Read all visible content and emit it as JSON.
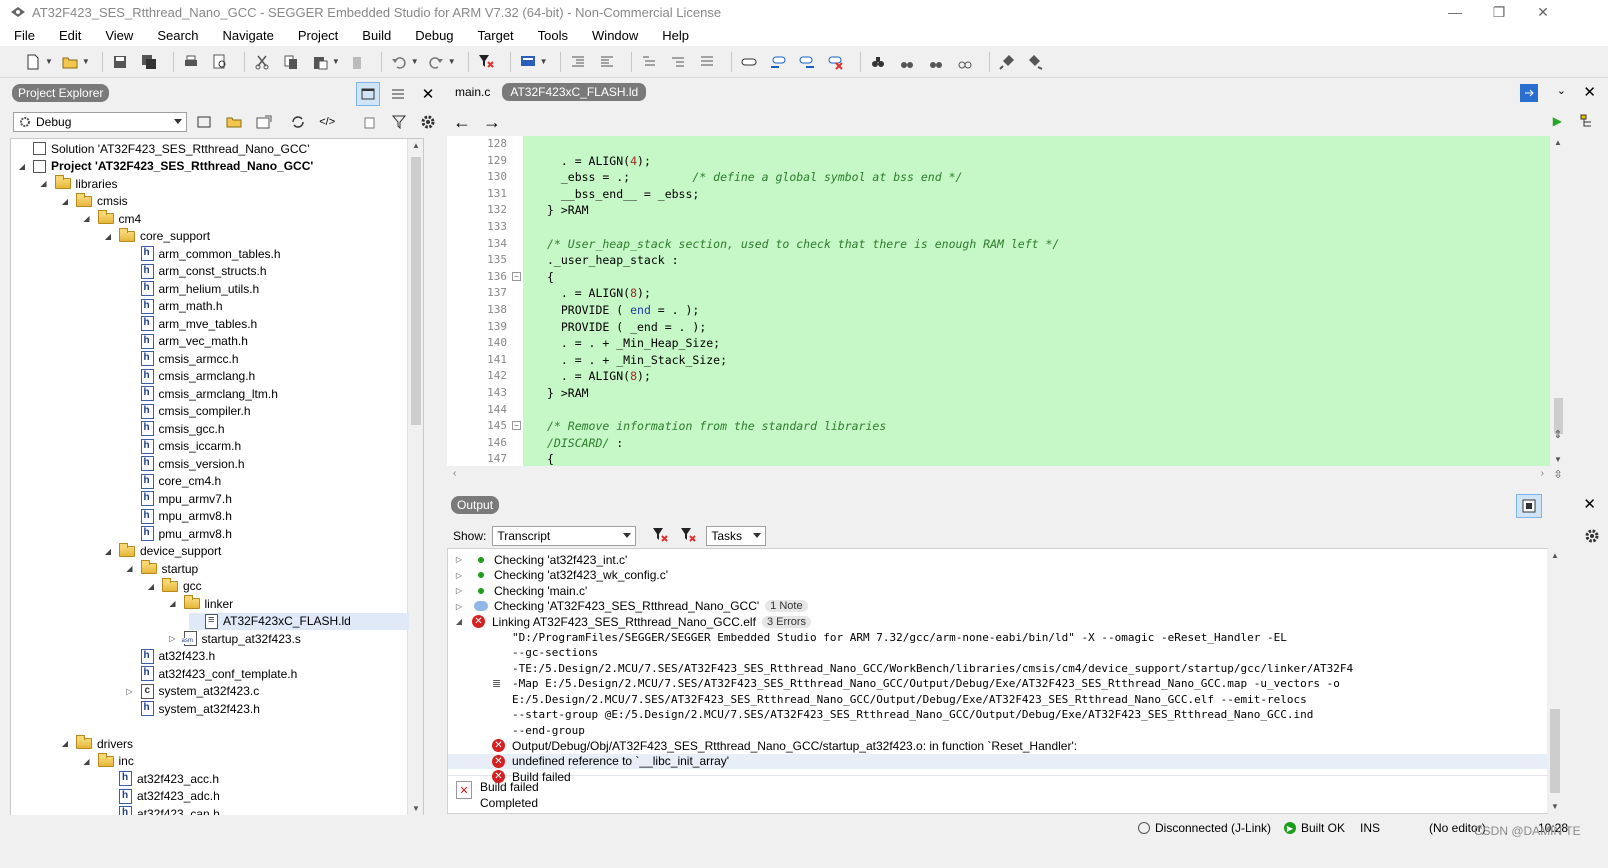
{
  "window": {
    "title": "AT32F423_SES_Rtthread_Nano_GCC - SEGGER Embedded Studio for ARM V7.32 (64-bit) - Non-Commercial License"
  },
  "menu": [
    "File",
    "Edit",
    "View",
    "Search",
    "Navigate",
    "Project",
    "Build",
    "Debug",
    "Target",
    "Tools",
    "Window",
    "Help"
  ],
  "project_explorer": {
    "header": "Project Explorer",
    "config": "Debug",
    "tree": [
      {
        "label": "Solution 'AT32F423_SES_Rtthread_Nano_GCC'",
        "depth": 0,
        "icon": "sol",
        "exp": ""
      },
      {
        "label": "Project 'AT32F423_SES_Rtthread_Nano_GCC'",
        "depth": 0,
        "icon": "proj",
        "exp": "◢",
        "bold": true
      },
      {
        "label": "libraries",
        "depth": 1,
        "icon": "folder",
        "exp": "◢"
      },
      {
        "label": "cmsis",
        "depth": 2,
        "icon": "folder",
        "exp": "◢"
      },
      {
        "label": "cm4",
        "depth": 3,
        "icon": "folder",
        "exp": "◢"
      },
      {
        "label": "core_support",
        "depth": 4,
        "icon": "folder",
        "exp": "◢"
      },
      {
        "label": "arm_common_tables.h",
        "depth": 5,
        "icon": "hfile",
        "exp": ""
      },
      {
        "label": "arm_const_structs.h",
        "depth": 5,
        "icon": "hfile",
        "exp": ""
      },
      {
        "label": "arm_helium_utils.h",
        "depth": 5,
        "icon": "hfile",
        "exp": ""
      },
      {
        "label": "arm_math.h",
        "depth": 5,
        "icon": "hfile",
        "exp": ""
      },
      {
        "label": "arm_mve_tables.h",
        "depth": 5,
        "icon": "hfile",
        "exp": ""
      },
      {
        "label": "arm_vec_math.h",
        "depth": 5,
        "icon": "hfile",
        "exp": ""
      },
      {
        "label": "cmsis_armcc.h",
        "depth": 5,
        "icon": "hfile",
        "exp": ""
      },
      {
        "label": "cmsis_armclang.h",
        "depth": 5,
        "icon": "hfile",
        "exp": ""
      },
      {
        "label": "cmsis_armclang_ltm.h",
        "depth": 5,
        "icon": "hfile",
        "exp": ""
      },
      {
        "label": "cmsis_compiler.h",
        "depth": 5,
        "icon": "hfile",
        "exp": ""
      },
      {
        "label": "cmsis_gcc.h",
        "depth": 5,
        "icon": "hfile",
        "exp": ""
      },
      {
        "label": "cmsis_iccarm.h",
        "depth": 5,
        "icon": "hfile",
        "exp": ""
      },
      {
        "label": "cmsis_version.h",
        "depth": 5,
        "icon": "hfile",
        "exp": ""
      },
      {
        "label": "core_cm4.h",
        "depth": 5,
        "icon": "hfile",
        "exp": ""
      },
      {
        "label": "mpu_armv7.h",
        "depth": 5,
        "icon": "hfile",
        "exp": ""
      },
      {
        "label": "mpu_armv8.h",
        "depth": 5,
        "icon": "hfile",
        "exp": ""
      },
      {
        "label": "pmu_armv8.h",
        "depth": 5,
        "icon": "hfile",
        "exp": ""
      },
      {
        "label": "device_support",
        "depth": 4,
        "icon": "folder",
        "exp": "◢"
      },
      {
        "label": "startup",
        "depth": 5,
        "icon": "folder",
        "exp": "◢"
      },
      {
        "label": "gcc",
        "depth": 6,
        "icon": "folder",
        "exp": "◢"
      },
      {
        "label": "linker",
        "depth": 7,
        "icon": "folder",
        "exp": "◢"
      },
      {
        "label": "AT32F423xC_FLASH.ld",
        "depth": 8,
        "icon": "ldfile",
        "exp": "",
        "selected": true
      },
      {
        "label": "startup_at32f423.s",
        "depth": 7,
        "icon": "asm",
        "exp": "▷"
      },
      {
        "label": "at32f423.h",
        "depth": 5,
        "icon": "hfile",
        "exp": ""
      },
      {
        "label": "at32f423_conf_template.h",
        "depth": 5,
        "icon": "hfile",
        "exp": ""
      },
      {
        "label": "system_at32f423.c",
        "depth": 5,
        "icon": "cfile",
        "exp": "▷"
      },
      {
        "label": "system_at32f423.h",
        "depth": 5,
        "icon": "hfile",
        "exp": ""
      },
      {
        "label": "",
        "depth": 0,
        "icon": "none",
        "exp": ""
      },
      {
        "label": "drivers",
        "depth": 2,
        "icon": "folder",
        "exp": "◢"
      },
      {
        "label": "inc",
        "depth": 3,
        "icon": "folder",
        "exp": "◢"
      },
      {
        "label": "at32f423_acc.h",
        "depth": 4,
        "icon": "hfile",
        "exp": ""
      },
      {
        "label": "at32f423_adc.h",
        "depth": 4,
        "icon": "hfile",
        "exp": ""
      },
      {
        "label": "at32f423_can.h",
        "depth": 4,
        "icon": "hfile",
        "exp": ""
      },
      {
        "label": "at32f423_crc.h",
        "depth": 4,
        "icon": "hfile",
        "exp": ""
      }
    ]
  },
  "editor": {
    "tabs": [
      "main.c",
      "AT32F423xC_FLASH.ld"
    ],
    "active_tab": "AT32F423xC_FLASH.ld",
    "lines": [
      {
        "n": "128",
        "html": ""
      },
      {
        "n": "129",
        "html": "  . = ALIGN(<span class='nm'>4</span>);"
      },
      {
        "n": "130",
        "html": "  _ebss = .;         <span class='cm'>/* define a global symbol at bss end */</span>"
      },
      {
        "n": "131",
        "html": "  __bss_end__ = _ebss;"
      },
      {
        "n": "132",
        "html": "} &gt;RAM"
      },
      {
        "n": "133",
        "html": ""
      },
      {
        "n": "134",
        "html": "<span class='cm'>/* User_heap_stack section, used to check that there is enough RAM left */</span>"
      },
      {
        "n": "135",
        "html": "._user_heap_stack :"
      },
      {
        "n": "136",
        "html": "{",
        "fold": true
      },
      {
        "n": "137",
        "html": "  . = ALIGN(<span class='nm'>8</span>);"
      },
      {
        "n": "138",
        "html": "  PROVIDE ( <span class='kw'>end</span> = . );"
      },
      {
        "n": "139",
        "html": "  PROVIDE ( _end = . );"
      },
      {
        "n": "140",
        "html": "  . = . + _Min_Heap_Size;"
      },
      {
        "n": "141",
        "html": "  . = . + _Min_Stack_Size;"
      },
      {
        "n": "142",
        "html": "  . = ALIGN(<span class='nm'>8</span>);"
      },
      {
        "n": "143",
        "html": "} &gt;RAM"
      },
      {
        "n": "144",
        "html": ""
      },
      {
        "n": "145",
        "html": "<span class='cm'>/* Remove information from the standard libraries</span>",
        "fold": true
      },
      {
        "n": "146",
        "html": "<span class='cm'>/DISCARD/</span> :"
      },
      {
        "n": "147",
        "html": "{"
      }
    ]
  },
  "output": {
    "header": "Output",
    "show_label": "Show:",
    "show_value": "Transcript",
    "tasks_value": "Tasks",
    "rows": [
      {
        "type": "dot",
        "text": "Checking 'at32f423_int.c'"
      },
      {
        "type": "dot",
        "text": "Checking 'at32f423_wk_config.c'"
      },
      {
        "type": "dot",
        "text": "Checking 'main.c'"
      },
      {
        "type": "note",
        "text": "Checking 'AT32F423_SES_Rtthread_Nano_GCC'",
        "badge": "1 Note"
      },
      {
        "type": "err_open",
        "text": "Linking AT32F423_SES_Rtthread_Nano_GCC.elf",
        "badge": "3 Errors"
      },
      {
        "type": "cmd",
        "text": "\"D:/ProgramFiles/SEGGER/SEGGER Embedded Studio for ARM 7.32/gcc/arm-none-eabi/bin/ld\" -X --omagic -eReset_Handler -EL"
      },
      {
        "type": "cmd",
        "text": "--gc-sections"
      },
      {
        "type": "cmd",
        "text": "-TE:/5.Design/2.MCU/7.SES/AT32F423_SES_Rtthread_Nano_GCC/WorkBench/libraries/cmsis/cm4/device_support/startup/gcc/linker/AT32F4"
      },
      {
        "type": "cmd",
        "text": "-Map E:/5.Design/2.MCU/7.SES/AT32F423_SES_Rtthread_Nano_GCC/Output/Debug/Exe/AT32F423_SES_Rtthread_Nano_GCC.map -u_vectors -o",
        "icon": true
      },
      {
        "type": "cmd",
        "text": "E:/5.Design/2.MCU/7.SES/AT32F423_SES_Rtthread_Nano_GCC/Output/Debug/Exe/AT32F423_SES_Rtthread_Nano_GCC.elf --emit-relocs"
      },
      {
        "type": "cmd",
        "text": "--start-group @E:/5.Design/2.MCU/7.SES/AT32F423_SES_Rtthread_Nano_GCC/Output/Debug/Exe/AT32F423_SES_Rtthread_Nano_GCC.ind"
      },
      {
        "type": "cmd",
        "text": "--end-group"
      },
      {
        "type": "err",
        "text": "Output/Debug/Obj/AT32F423_SES_Rtthread_Nano_GCC/startup_at32f423.o: in function `Reset_Handler':"
      },
      {
        "type": "err",
        "text": "undefined reference to `__libc_init_array'",
        "highlight": true
      },
      {
        "type": "err",
        "text": "Build failed"
      }
    ],
    "summary_title": "Build failed",
    "summary_sub": "Completed"
  },
  "status": {
    "connection": "Disconnected (J-Link)",
    "build": "Built OK",
    "mode": "INS",
    "editor": "(No editor)",
    "time": "10:28",
    "watermark": "CSDN @DAMIN TE"
  }
}
